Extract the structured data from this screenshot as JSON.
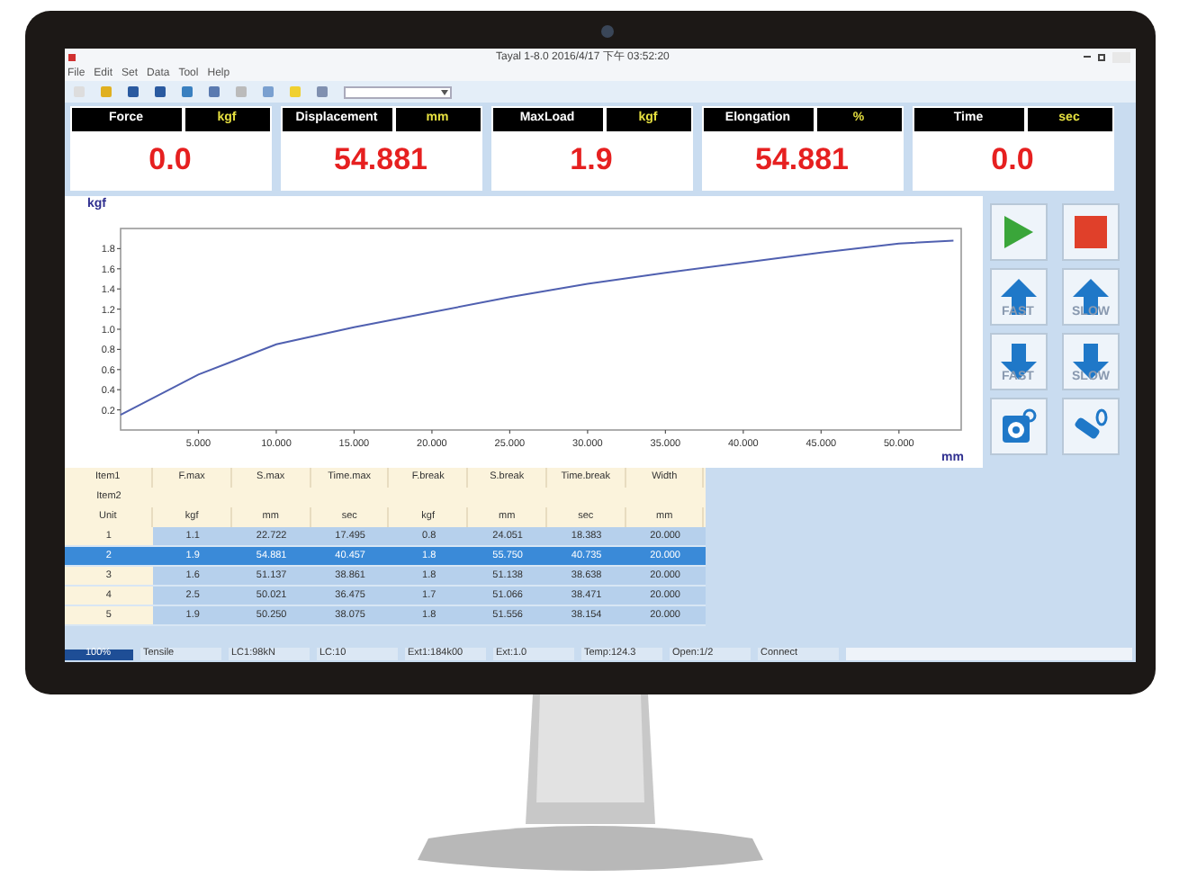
{
  "window": {
    "title": "Tayal 1-8.0 2016/4/17 下午 03:52:20"
  },
  "menu": [
    "File",
    "Edit",
    "Set",
    "Data",
    "Tool",
    "Help"
  ],
  "readouts": [
    {
      "label": "Force",
      "unit": "kgf",
      "value": "0.0"
    },
    {
      "label": "Displacement",
      "unit": "mm",
      "value": "54.881"
    },
    {
      "label": "MaxLoad",
      "unit": "kgf",
      "value": "1.9"
    },
    {
      "label": "Elongation",
      "unit": "%",
      "value": "54.881"
    },
    {
      "label": "Time",
      "unit": "sec",
      "value": "0.0"
    }
  ],
  "chart": {
    "chart_data": {
      "type": "line",
      "xlabel": "mm",
      "ylabel": "kgf",
      "xlim": [
        0,
        54
      ],
      "ylim": [
        0,
        2
      ],
      "xticks": [
        {
          "value": 5,
          "label": "5.000"
        },
        {
          "value": 10,
          "label": "10.000"
        },
        {
          "value": 15,
          "label": "15.000"
        },
        {
          "value": 20,
          "label": "20.000"
        },
        {
          "value": 25,
          "label": "25.000"
        },
        {
          "value": 30,
          "label": "30.000"
        },
        {
          "value": 35,
          "label": "35.000"
        },
        {
          "value": 40,
          "label": "40.000"
        },
        {
          "value": 45,
          "label": "45.000"
        },
        {
          "value": 50,
          "label": "50.000"
        }
      ],
      "yticks": [
        {
          "value": 0.2,
          "label": "0.2"
        },
        {
          "value": 0.4,
          "label": "0.4"
        },
        {
          "value": 0.6,
          "label": "0.6"
        },
        {
          "value": 0.8,
          "label": "0.8"
        },
        {
          "value": 1.0,
          "label": "1.0"
        },
        {
          "value": 1.2,
          "label": "1.2"
        },
        {
          "value": 1.4,
          "label": "1.4"
        },
        {
          "value": 1.6,
          "label": "1.6"
        },
        {
          "value": 1.8,
          "label": "1.8"
        }
      ],
      "x": [
        0,
        5,
        10,
        15,
        20,
        25,
        30,
        35,
        40,
        45,
        50,
        53.5
      ],
      "series": [
        {
          "color": "#5060b0",
          "values": [
            0.15,
            0.55,
            0.85,
            1.02,
            1.17,
            1.32,
            1.45,
            1.56,
            1.66,
            1.76,
            1.85,
            1.88
          ]
        }
      ]
    }
  },
  "controls": [
    {
      "kind": "start"
    },
    {
      "kind": "stop"
    },
    {
      "kind": "up",
      "label": "FAST"
    },
    {
      "kind": "up",
      "label": "SLOW"
    },
    {
      "kind": "down",
      "label": "FAST"
    },
    {
      "kind": "down",
      "label": "SLOW"
    },
    {
      "kind": "reset"
    },
    {
      "kind": "tool"
    }
  ],
  "table": {
    "columns": [
      "Item1",
      "F.max",
      "S.max",
      "Time.max",
      "F.break",
      "S.break",
      "Time.break",
      "Width"
    ],
    "item2": "Item2",
    "units": [
      "Unit",
      "kgf",
      "mm",
      "sec",
      "kgf",
      "mm",
      "sec",
      "mm"
    ],
    "rows": [
      {
        "selected": false,
        "cells": [
          "1",
          "1.1",
          "22.722",
          "17.495",
          "0.8",
          "24.051",
          "18.383",
          "20.000"
        ]
      },
      {
        "selected": true,
        "cells": [
          "2",
          "1.9",
          "54.881",
          "40.457",
          "1.8",
          "55.750",
          "40.735",
          "20.000"
        ]
      },
      {
        "selected": false,
        "cells": [
          "3",
          "1.6",
          "51.137",
          "38.861",
          "1.8",
          "51.138",
          "38.638",
          "20.000"
        ]
      },
      {
        "selected": false,
        "cells": [
          "4",
          "2.5",
          "50.021",
          "36.475",
          "1.7",
          "51.066",
          "38.471",
          "20.000"
        ]
      },
      {
        "selected": false,
        "cells": [
          "5",
          "1.9",
          "50.250",
          "38.075",
          "1.8",
          "51.556",
          "38.154",
          "20.000"
        ]
      }
    ]
  },
  "status_bar": {
    "progress": {
      "label": "100%",
      "level": 1
    },
    "fields": [
      "Tensile",
      "LC1:98kN",
      "LC:10",
      "Ext1:184k00",
      "Ext:1.0",
      "Temp:124.3",
      "Open:1/2",
      "Connect"
    ]
  }
}
